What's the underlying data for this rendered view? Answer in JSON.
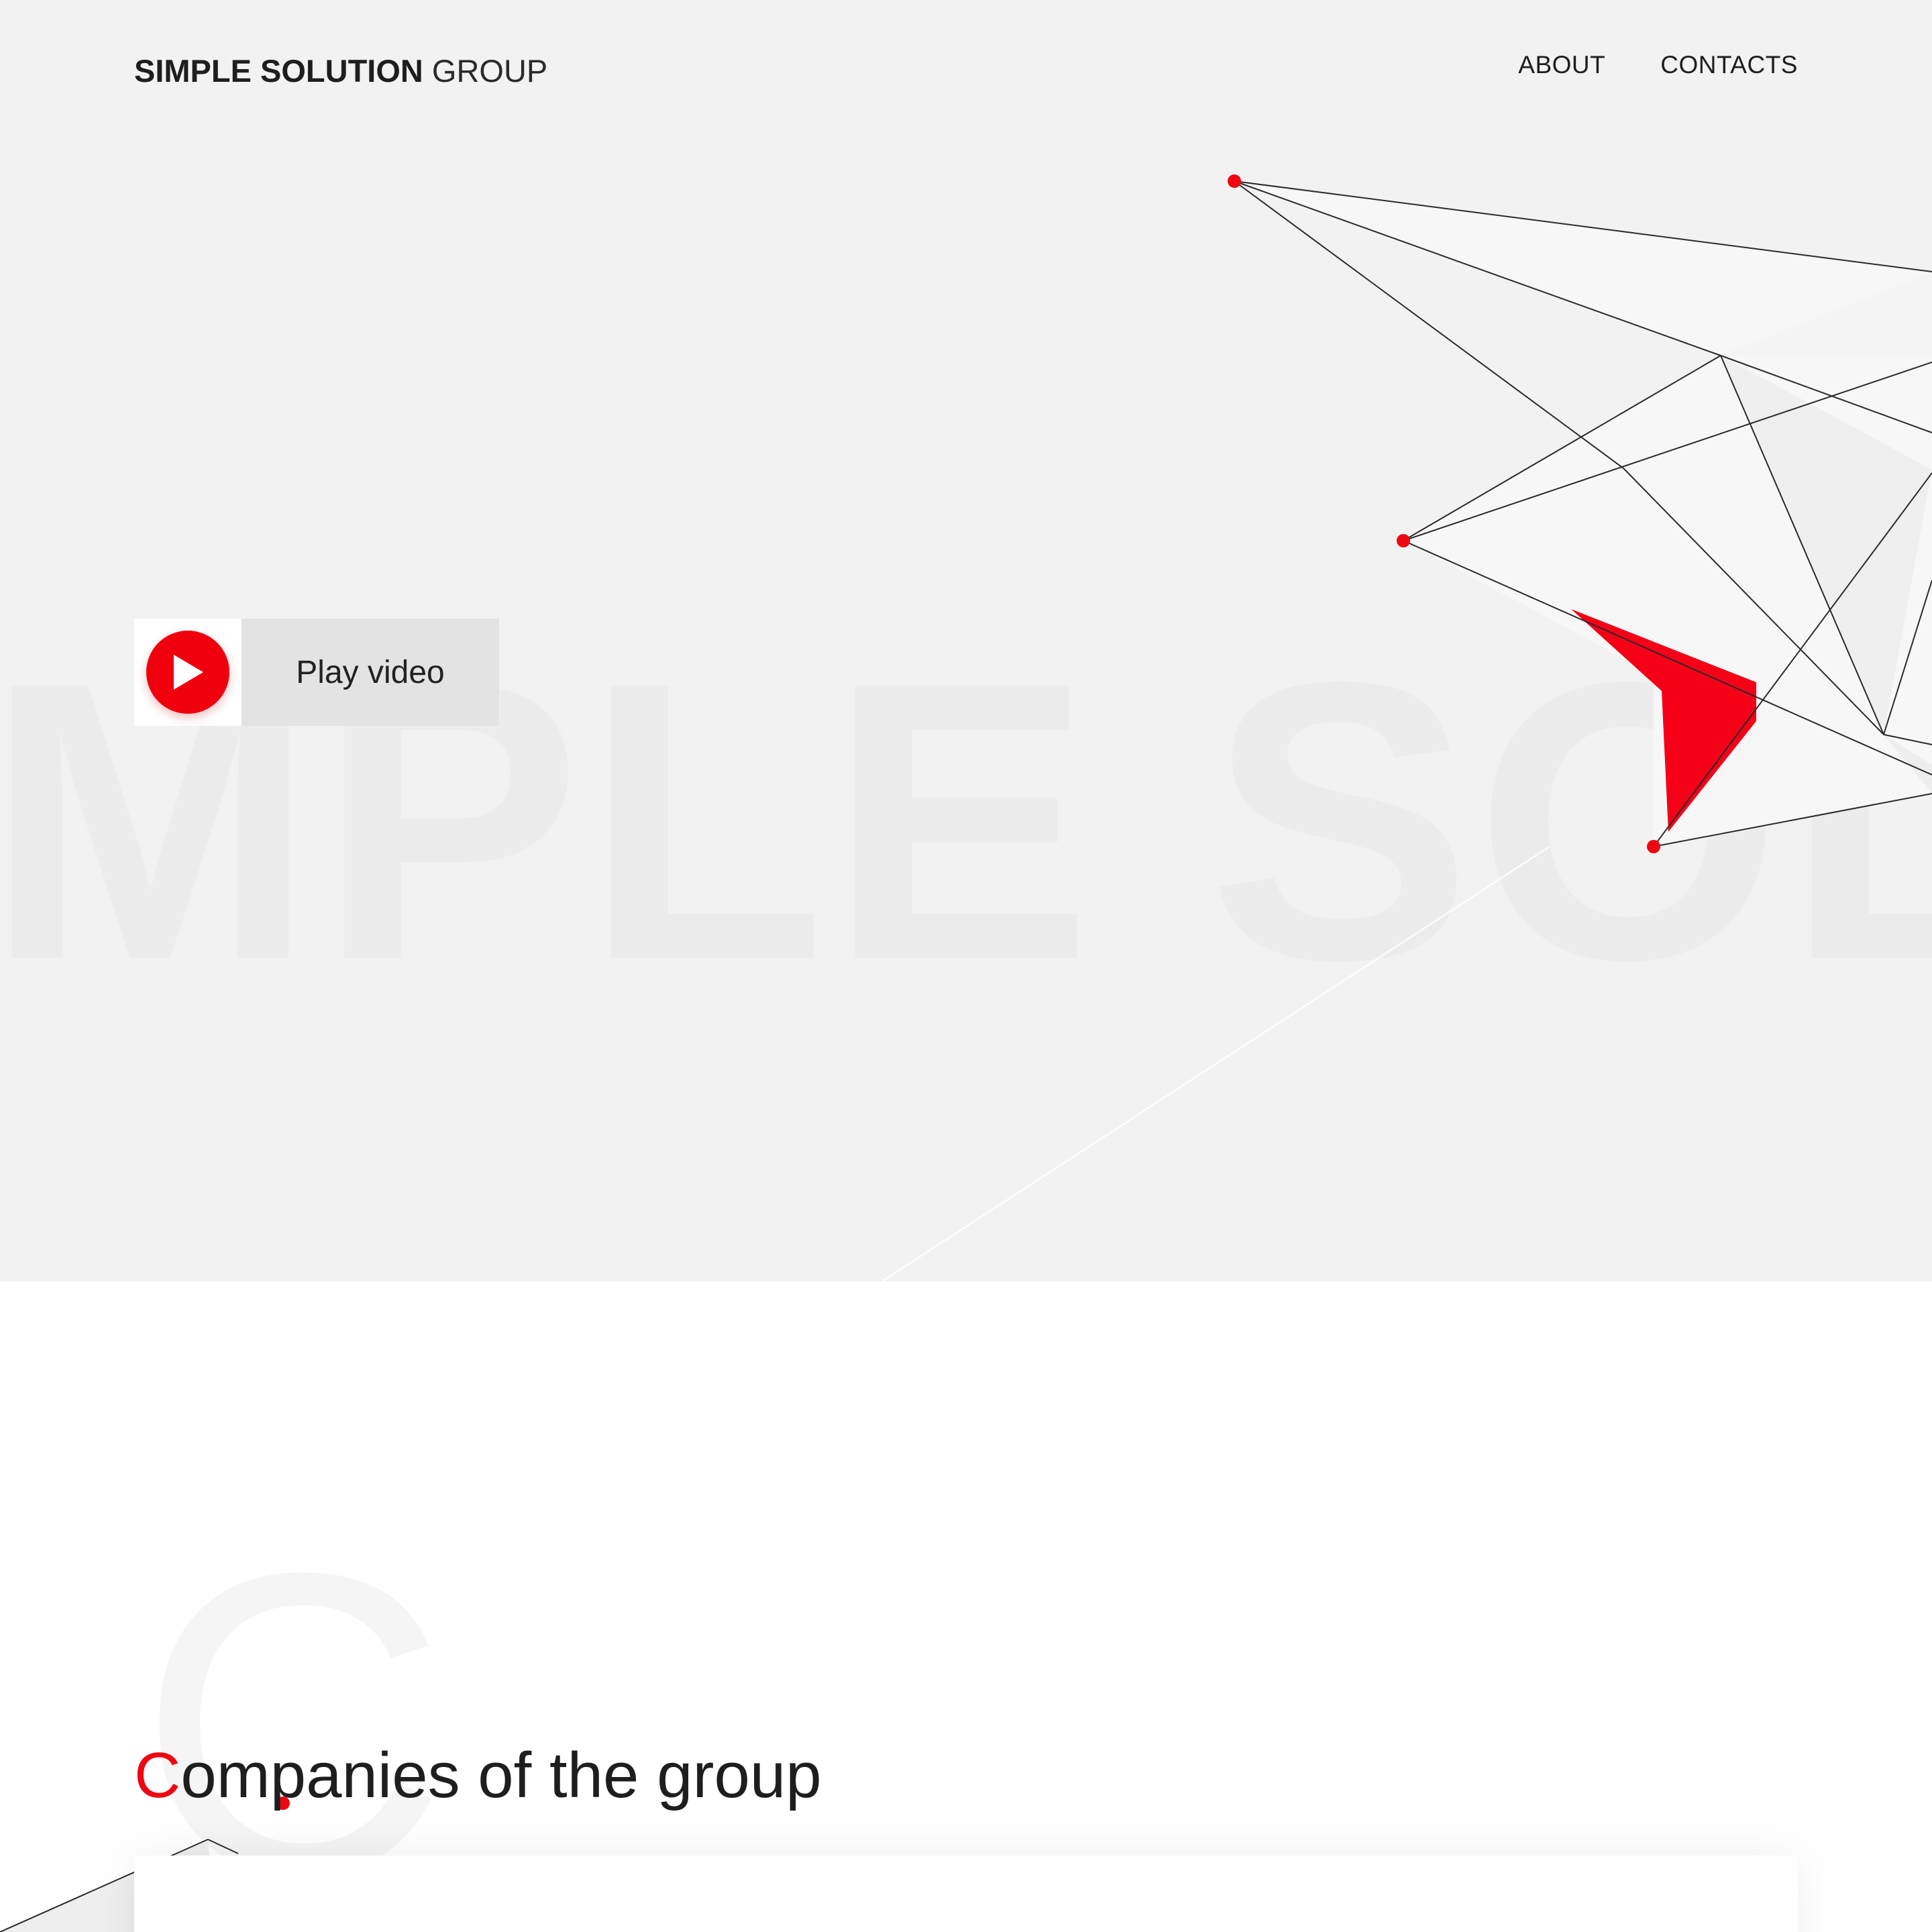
{
  "header": {
    "logo_bold": "SIMPLE SOLUTION",
    "logo_light": " GROUP",
    "nav": {
      "about": "ABOUT",
      "contacts": "CONTACTS"
    }
  },
  "hero": {
    "background_text": "IMPLE SOL",
    "play_button": {
      "label": "Play video",
      "icon": "play-icon"
    }
  },
  "companies": {
    "title_accent": "C",
    "title_rest": "ompanies of the group",
    "background_letter": "C"
  },
  "colors": {
    "accent": "#ee0710",
    "hero_background": "#f2f2f2",
    "text": "#1e1e1e"
  }
}
